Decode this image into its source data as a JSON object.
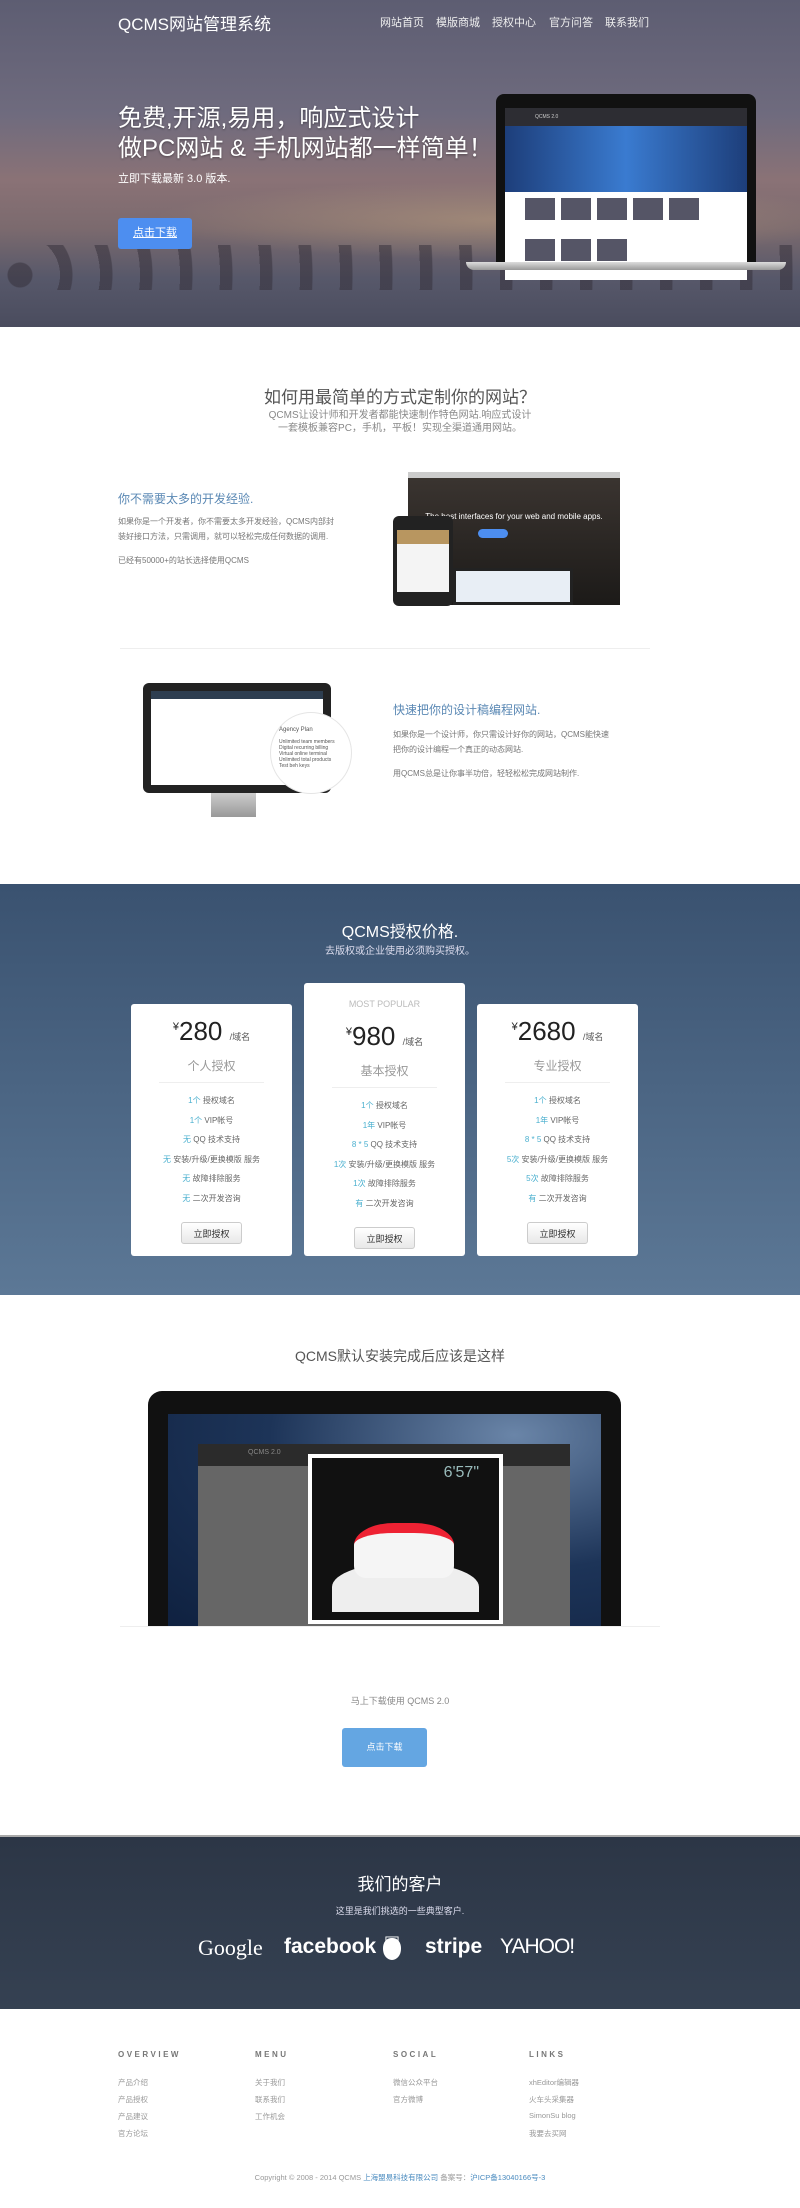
{
  "header": {
    "logo": "QCMS网站管理系统",
    "nav": [
      "网站首页",
      "模版商城",
      "授权中心",
      "官方问答",
      "联系我们"
    ]
  },
  "hero": {
    "line1": "免费,开源,易用，响应式设计",
    "line2": "做PC网站 & 手机网站都一样简单！",
    "subtitle": "立即下载最新 3.0 版本.",
    "button": "点击下载",
    "screen_brand": "QCMS 2.0"
  },
  "intro": {
    "title": "如何用最简单的方式定制你的网站？",
    "text1": "QCMS让设计师和开发者都能快速制作特色网站.响应式设计",
    "text2": "一套模板兼容PC，手机，平板！实现全渠道通用网站。"
  },
  "feature1": {
    "heading": "你不需要太多的开发经验.",
    "p1": "如果你是一个开发者，你不需要太多开发经验，QCMS内部封装好接口方法，只需调用，就可以轻松完成任何数据的调用.",
    "p2": "已经有50000+的站长选择使用QCMS",
    "screen_headline": "The best interfaces for your web and mobile apps."
  },
  "feature2": {
    "heading": "快速把你的设计稿编程网站.",
    "p1": "如果你是一个设计师，你只需设计好你的网站，QCMS能快速把你的设计编程一个真正的动态网站.",
    "p2": "用QCMS总是让你事半功倍，轻轻松松完成网站制作.",
    "plan_title": "Agency Plan",
    "plan_items": [
      "Unlimited team members",
      "Digital recurring billing",
      "Virtual online terminal",
      "Unlimited total products",
      "Test beh keys"
    ]
  },
  "pricing": {
    "title": "QCMS授权价格.",
    "subtitle": "去版权或企业使用必须购买授权。",
    "currency": "¥",
    "unit": "/域名",
    "button": "立即授权",
    "popular": "MOST POPULAR",
    "plans": [
      {
        "price": "280",
        "name": "个人授权",
        "features": [
          [
            "1个",
            "授权域名"
          ],
          [
            "1个",
            "VIP帐号"
          ],
          [
            "无",
            "QQ 技术支持"
          ],
          [
            "无",
            "安装/升级/更换模版 服务"
          ],
          [
            "无",
            "故障排除服务"
          ],
          [
            "无",
            "二次开发咨询"
          ]
        ]
      },
      {
        "price": "980",
        "name": "基本授权",
        "features": [
          [
            "1个",
            "授权域名"
          ],
          [
            "1年",
            "VIP帐号"
          ],
          [
            "8 * 5",
            "QQ 技术支持"
          ],
          [
            "1次",
            "安装/升级/更换模版 服务"
          ],
          [
            "1次",
            "故障排除服务"
          ],
          [
            "有",
            "二次开发咨询"
          ]
        ]
      },
      {
        "price": "2680",
        "name": "专业授权",
        "features": [
          [
            "1个",
            "授权域名"
          ],
          [
            "1年",
            "VIP帐号"
          ],
          [
            "8 * 5",
            "QQ 技术支持"
          ],
          [
            "5次",
            "安装/升级/更换模版 服务"
          ],
          [
            "5次",
            "故障排除服务"
          ],
          [
            "有",
            "二次开发咨询"
          ]
        ]
      }
    ]
  },
  "install": {
    "title": "QCMS默认安装完成后应该是这样",
    "screen_brand": "QCMS 2.0",
    "lap_time": "6'57\""
  },
  "download": {
    "text": "马上下载使用 QCMS 2.0",
    "button": "点击下载"
  },
  "clients": {
    "title": "我们的客户",
    "subtitle": "这里是我们挑选的一些典型客户.",
    "logos": [
      "Google",
      "facebook",
      "apple-logo",
      "stripe",
      "YAHOO!"
    ]
  },
  "footer": {
    "columns": [
      {
        "heading": "OVERVIEW",
        "items": [
          "产品介绍",
          "产品授权",
          "产品建议",
          "官方论坛"
        ]
      },
      {
        "heading": "MENU",
        "items": [
          "关于我们",
          "联系我们",
          "工作机会"
        ]
      },
      {
        "heading": "SOCIAL",
        "items": [
          "微信公众平台",
          "官方微博"
        ]
      },
      {
        "heading": "LINKS",
        "items": [
          "xhEditor编辑器",
          "火车头采集器",
          "SimonSu blog",
          "我要去买网"
        ]
      }
    ],
    "copyright": "Copyright © 2008 - 2014  QCMS",
    "company": "上海盟易科技有限公司",
    "icp_label": "备案号：",
    "icp": "沪ICP备13040166号-3"
  },
  "colors": {
    "accent": "#4d8ef0",
    "highlight": "#4bb0cf",
    "pricing_bg": "#3a5270",
    "clients_bg": "#2c3646"
  }
}
